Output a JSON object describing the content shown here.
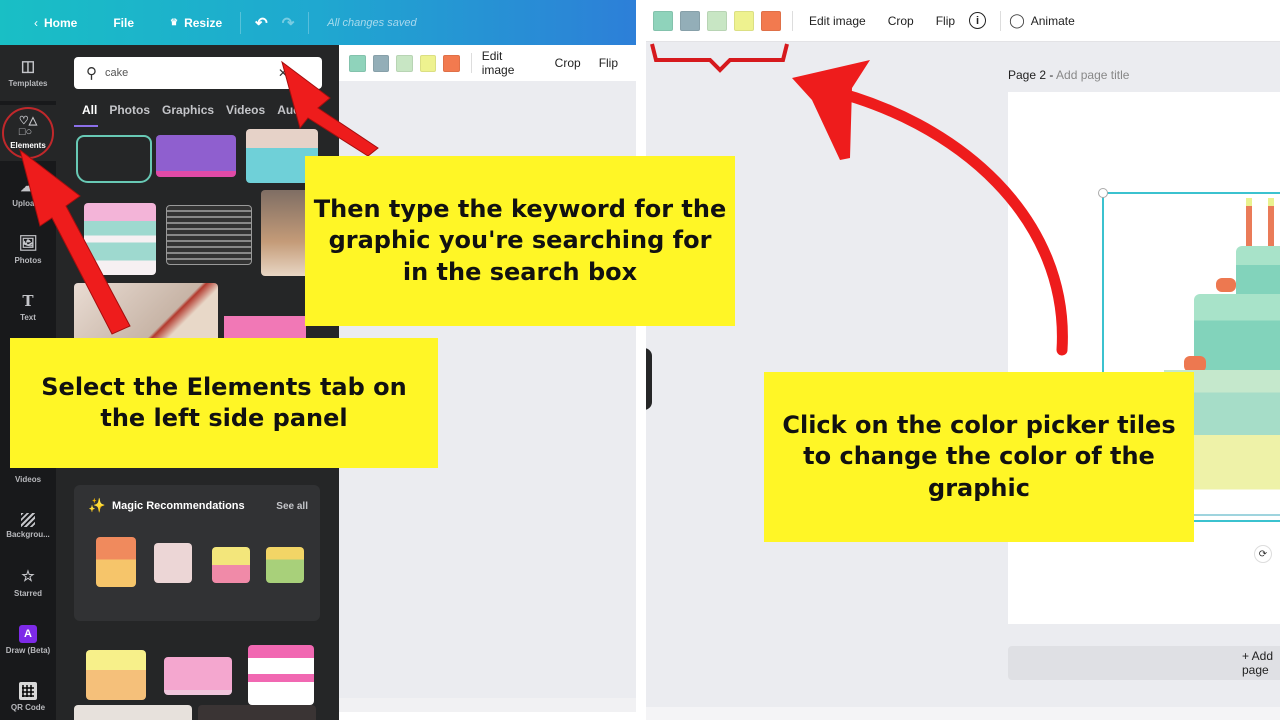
{
  "left_screen": {
    "topbar": {
      "home_label": "Home",
      "file_label": "File",
      "resize_label": "Resize",
      "status": "All changes saved"
    },
    "rail": {
      "items": [
        {
          "label": "Templates",
          "icon": "templates-icon"
        },
        {
          "label": "Elements",
          "icon": "shapes-icon"
        },
        {
          "label": "Uploads",
          "icon": "upload-icon"
        },
        {
          "label": "Photos",
          "icon": "photos-icon"
        },
        {
          "label": "Text",
          "icon": "text-icon"
        },
        {
          "label": "Videos",
          "icon": "videos-icon"
        },
        {
          "label": "Backgrou...",
          "icon": "background-icon"
        },
        {
          "label": "Starred",
          "icon": "star-icon"
        },
        {
          "label": "Draw (Beta)",
          "icon": "draw-icon"
        },
        {
          "label": "QR Code",
          "icon": "qr-code-icon"
        }
      ]
    },
    "panel": {
      "search_value": "cake",
      "tabs": [
        "All",
        "Photos",
        "Graphics",
        "Videos",
        "Audio"
      ],
      "active_tab": "All",
      "magic": {
        "title": "Magic Recommendations",
        "see_all": "See all"
      }
    },
    "context_bar": {
      "swatches": [
        "#8fd3bb",
        "#93aeb8",
        "#c8e6c4",
        "#eef28f",
        "#f27a4f"
      ],
      "edit_image": "Edit image",
      "crop": "Crop",
      "flip": "Flip"
    }
  },
  "right_screen": {
    "context_bar": {
      "swatches": [
        "#8fd3bb",
        "#93aeb8",
        "#c8e6c4",
        "#eef28f",
        "#f27a4f"
      ],
      "edit_image": "Edit image",
      "crop": "Crop",
      "flip": "Flip",
      "animate": "Animate"
    },
    "page_label": "Page 2 -",
    "page_title_placeholder": "Add page title",
    "add_page": "+ Add page"
  },
  "callouts": {
    "search": "Then type the keyword for the graphic you're searching for in the search box",
    "elements": "Select the Elements tab on the left side panel",
    "color": "Click on the color picker tiles to change the color of the graphic"
  },
  "colors": {
    "callout_bg": "#fff626",
    "arrow": "#ee1c1c",
    "selection": "#3bc2cf"
  }
}
